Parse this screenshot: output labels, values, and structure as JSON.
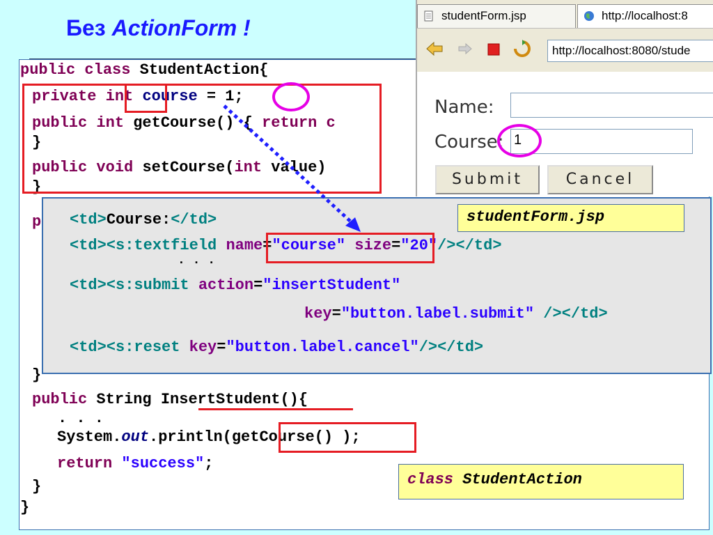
{
  "slide": {
    "title_prefix": "Без ",
    "title_em": "ActionForm !"
  },
  "java": {
    "l1_kw": "public class ",
    "l1_rest": "StudentAction{",
    "l2_kw": "private ",
    "l2_type": "int",
    "l2_var": "course",
    "l2_eq": " = ",
    "l2_val": "1",
    "l2_end": ";",
    "l3_kw": "public int ",
    "l3_rest": "getCourse() { ",
    "l3_ret": "return c",
    "l4": "}",
    "l5_kw": "public void ",
    "l5_rest": "setCourse(",
    "l5_int": "int",
    "l5_rest2": " value)",
    "l6": "}",
    "hidden_p": "p",
    "close1": "}",
    "m_kw": "public ",
    "m_type": "String ",
    "m_name": "InsertStudent",
    "m_end": "(){",
    "dots": ". . .",
    "sys_a": "System.",
    "sys_out": "out",
    "sys_b": ".println(",
    "sys_call": "getCourse()",
    "sys_end": " );",
    "ret_kw": "return ",
    "ret_str": "\"success\"",
    "ret_end": ";",
    "close2": "}",
    "close3": "}"
  },
  "jsp": {
    "r1_td": "<td>",
    "r1_text": "Course:",
    "r1_tdc": "</td>",
    "r2_td": "<td><s:textfield ",
    "r2_name": "name",
    "r2_eq": "=",
    "r2_nameval": "\"course\"",
    "r2_size": " size",
    "r2_eq2": "=",
    "r2_sizeval": "\"20\"",
    "r2_end": "/></td>",
    "r2_dots": ". . .",
    "r3_td": "<td><s:submit ",
    "r3_action": "action",
    "r3_eq": "=",
    "r3_val": "\"insertStudent\"",
    "r4_key": "key",
    "r4_eq": "=",
    "r4_val": "\"button.label.submit\"",
    "r4_end": " /></td>",
    "r5_td": "<td><s:reset ",
    "r5_key": "key",
    "r5_eq": "=",
    "r5_val": "\"button.label.cancel\"",
    "r5_end": "/></td>"
  },
  "notes": {
    "jsp_file": "studentForm.jsp",
    "class_kw": "class ",
    "class_name": "StudentAction"
  },
  "browser": {
    "tab1_label": "studentForm.jsp",
    "tab2_label": "http://localhost:8",
    "url_value": "http://localhost:8080/stude",
    "name_label": "Name:",
    "name_value": "",
    "course_label": "Course:",
    "course_value": "1",
    "submit_label": "Submit",
    "cancel_label": "Cancel"
  },
  "colors": {
    "background": "#ccffff",
    "title": "#1a1aff",
    "highlight_box": "#e51c23",
    "circle": "#e600e6",
    "arrow": "#1f1fff",
    "note_bg": "#ffff99"
  }
}
